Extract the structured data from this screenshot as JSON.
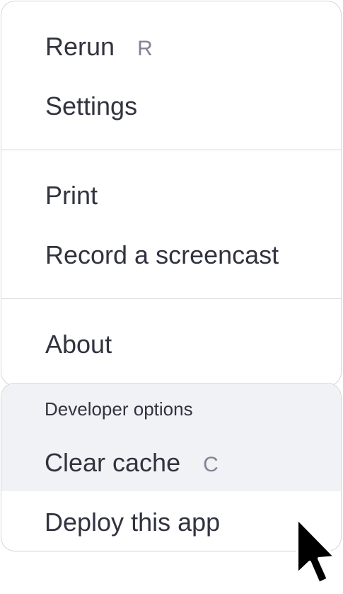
{
  "menu": {
    "rerun": {
      "label": "Rerun",
      "shortcut": "R"
    },
    "settings": {
      "label": "Settings"
    },
    "print": {
      "label": "Print"
    },
    "record": {
      "label": "Record a screencast"
    },
    "about": {
      "label": "About"
    }
  },
  "developer": {
    "header": "Developer options",
    "clear_cache": {
      "label": "Clear cache",
      "shortcut": "C"
    },
    "deploy": {
      "label": "Deploy this app"
    }
  },
  "colors": {
    "text": "#31333f",
    "shortcut": "#808495",
    "border": "#d6d6da",
    "dev_background": "#f0f2f6"
  },
  "icons": {
    "cursor": "mouse-pointer-icon"
  }
}
